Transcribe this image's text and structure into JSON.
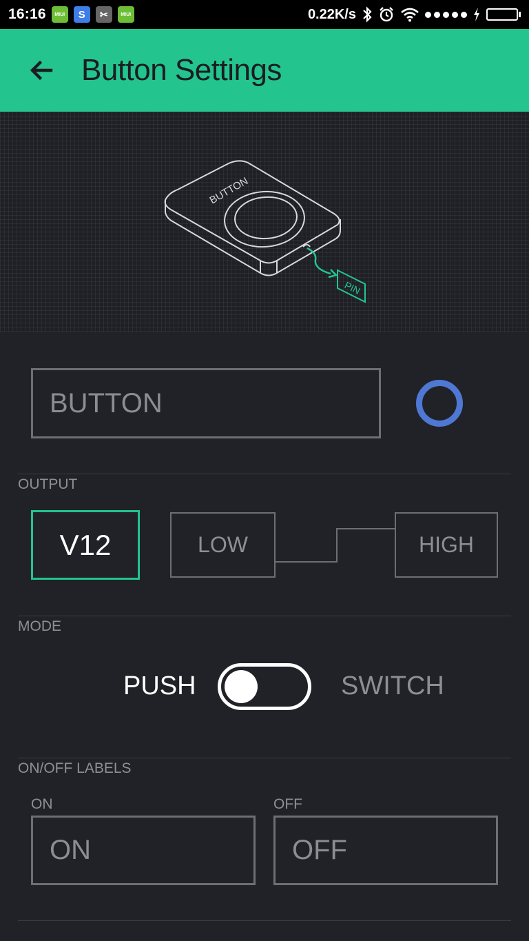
{
  "status_bar": {
    "time": "16:16",
    "app_icons": [
      {
        "name": "miui-store-icon",
        "text": "MIUI",
        "color": "#6dbd36"
      },
      {
        "name": "skype-icon",
        "text": "S",
        "color": "#3e7ee8"
      },
      {
        "name": "app-icon",
        "text": "✂",
        "color": "#666666"
      },
      {
        "name": "miui-store-icon-2",
        "text": "MIUI",
        "color": "#6dbd36"
      }
    ],
    "net_speed": "0.22K/s",
    "right_icons": [
      "bluetooth-icon",
      "alarm-icon",
      "wifi-icon",
      "signal-icon",
      "charging-icon",
      "battery-icon"
    ],
    "battery_level": 1.0
  },
  "app_bar": {
    "back_icon": "arrow-left-icon",
    "title": "Button Settings",
    "color": "#23c48e"
  },
  "illustration": {
    "button_text": "BUTTON",
    "pin_text": "PIN"
  },
  "widget_name": {
    "value": "BUTTON",
    "color": "#4e78d3"
  },
  "output": {
    "label": "OUTPUT",
    "pin": "V12",
    "low_label": "LOW",
    "high_label": "HIGH"
  },
  "mode": {
    "label": "MODE",
    "push_label": "PUSH",
    "switch_label": "SWITCH",
    "selected": "PUSH"
  },
  "labels": {
    "section_label": "ON/OFF LABELS",
    "on_field_label": "ON",
    "on_value": "ON",
    "off_field_label": "OFF",
    "off_value": "OFF"
  },
  "colors": {
    "accent": "#23c48e",
    "background": "#212227",
    "widget_color": "#4e78d3"
  }
}
